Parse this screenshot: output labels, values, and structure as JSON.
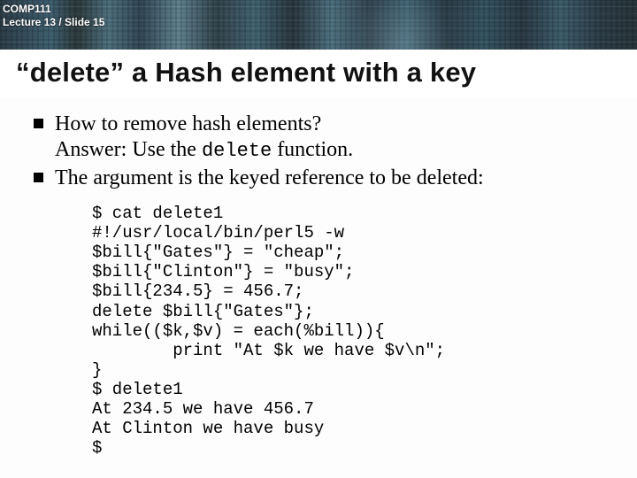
{
  "header": {
    "course": "COMP111",
    "lecture_slide": "Lecture 13 / Slide 15"
  },
  "title": "“delete” a Hash element with a key",
  "bullets": [
    {
      "line1": "How to remove hash elements?",
      "line2_pre": "Answer: Use the ",
      "line2_code": "delete",
      "line2_post": " function."
    },
    {
      "line1": "The argument is the keyed reference to be deleted:"
    }
  ],
  "code": "$ cat delete1\n#!/usr/local/bin/perl5 -w\n$bill{\"Gates\"} = \"cheap\";\n$bill{\"Clinton\"} = \"busy\";\n$bill{234.5} = 456.7;\ndelete $bill{\"Gates\"};\nwhile(($k,$v) = each(%bill)){\n        print \"At $k we have $v\\n\";\n}\n$ delete1\nAt 234.5 we have 456.7\nAt Clinton we have busy\n$"
}
